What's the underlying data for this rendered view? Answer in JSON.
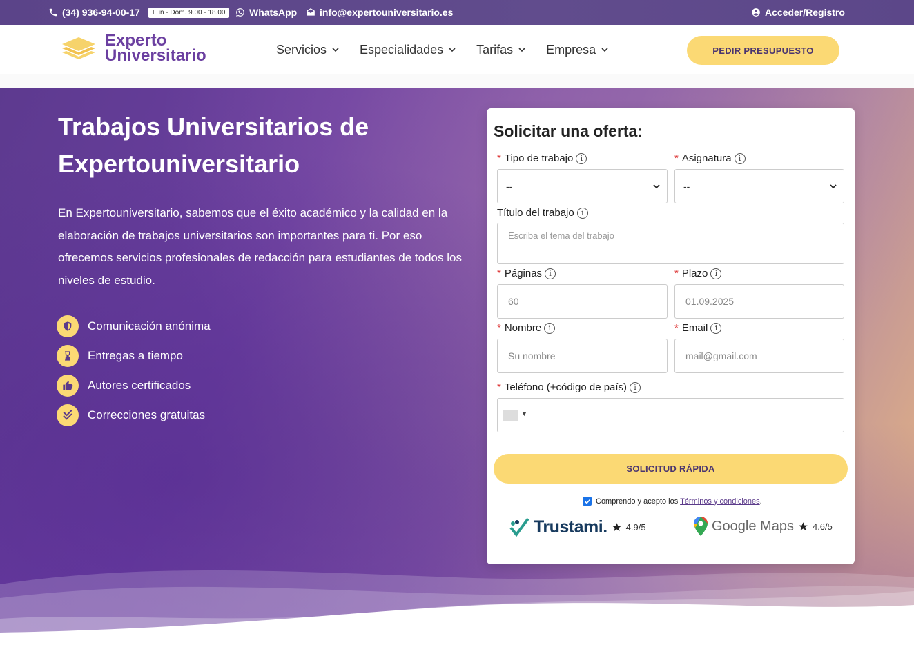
{
  "topbar": {
    "phone": "(34) 936-94-00-17",
    "hours": "Lun - Dom. 9.00 - 18.00",
    "whatsapp": "WhatsApp",
    "email": "info@expertouniversitario.es",
    "login": "Acceder/Registro"
  },
  "header": {
    "logo_line1": "Experto",
    "logo_line2": "Universitario",
    "nav": [
      "Servicios",
      "Especialidades",
      "Tarifas",
      "Empresa"
    ],
    "cta": "PEDIR PRESUPUESTO"
  },
  "hero": {
    "title": "Trabajos Universitarios de Expertouniversitario",
    "text": "En Expertouniversitario, sabemos que el éxito académico y la calidad en la elaboración de trabajos universitarios son importantes para ti. Por eso ofrecemos servicios profesionales de redacción para estudiantes de todos los niveles de estudio.",
    "features": [
      "Comunicación anónima",
      "Entregas a tiempo",
      "Autores certificados",
      "Correcciones gratuitas"
    ]
  },
  "form": {
    "title": "Solicitar una oferta:",
    "tipo_label": "Tipo de trabajo",
    "tipo_value": "--",
    "asignatura_label": "Asignatura",
    "asignatura_value": "--",
    "titulo_label": "Título del trabajo",
    "titulo_placeholder": "Escriba el tema del trabajo",
    "paginas_label": "Páginas",
    "paginas_placeholder": "60",
    "plazo_label": "Plazo",
    "plazo_placeholder": "01.09.2025",
    "nombre_label": "Nombre",
    "nombre_placeholder": "Su nombre",
    "email_label": "Email",
    "email_placeholder": "mail@gmail.com",
    "telefono_label": "Teléfono (+código de país)",
    "submit": "SOLICITUD RÁPIDA",
    "terms_text": "Comprendo y acepto los",
    "terms_link": "Términos y condiciones",
    "terms_end": ".",
    "info_glyph": "i",
    "required_mark": "*"
  },
  "ratings": {
    "trustami_name": "Trustami.",
    "trustami_score": "4.9/5",
    "gmaps_name": "Google Maps",
    "gmaps_score": "4.6/5"
  },
  "colors": {
    "topbar": "#5f4b8b",
    "accent_yellow": "#fbd974",
    "brand_purple": "#6b3fa0"
  }
}
